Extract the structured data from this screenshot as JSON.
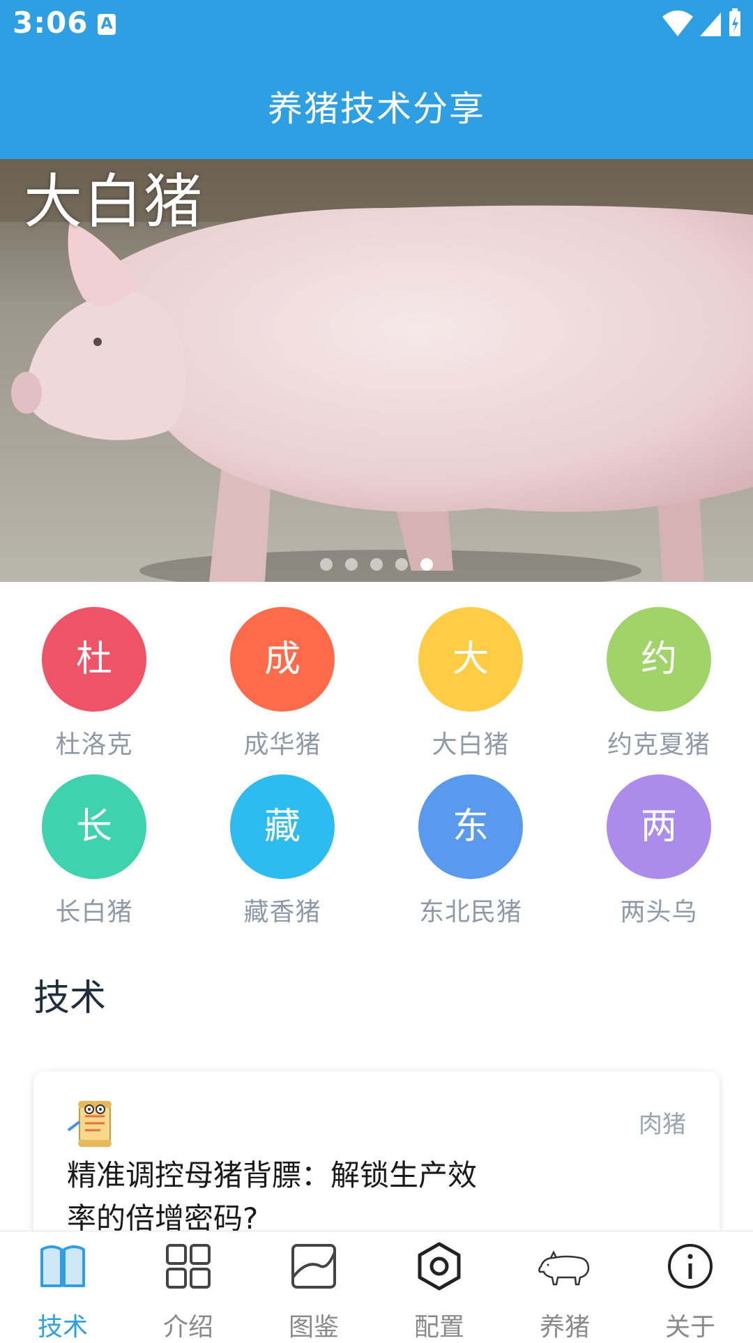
{
  "status_bar": {
    "time": "3:06",
    "notification_icon": "A"
  },
  "app_bar": {
    "title": "养猪技术分享"
  },
  "banner": {
    "caption": "大白猪",
    "page_count": 5,
    "active_index": 4
  },
  "categories": [
    {
      "initial": "杜",
      "label": "杜洛克",
      "color": "#ef5367"
    },
    {
      "initial": "成",
      "label": "成华猪",
      "color": "#fd6b4b"
    },
    {
      "initial": "大",
      "label": "大白猪",
      "color": "#fecd45"
    },
    {
      "initial": "约",
      "label": "约克夏猪",
      "color": "#a0d468"
    },
    {
      "initial": "长",
      "label": "长白猪",
      "color": "#3ed2ad"
    },
    {
      "initial": "藏",
      "label": "藏香猪",
      "color": "#2cbcf0"
    },
    {
      "initial": "东",
      "label": "东北民猪",
      "color": "#5a9aee"
    },
    {
      "initial": "两",
      "label": "两头乌",
      "color": "#ab8ceb"
    }
  ],
  "section": {
    "title": "技术"
  },
  "article": {
    "tag": "肉猪",
    "title": "精准调控母猪背膘：解锁生产效率的倍增密码?"
  },
  "bottom_nav": [
    {
      "label": "技术",
      "icon": "book-icon",
      "active": true
    },
    {
      "label": "介绍",
      "icon": "grid-icon",
      "active": false
    },
    {
      "label": "图鉴",
      "icon": "gallery-icon",
      "active": false
    },
    {
      "label": "配置",
      "icon": "hexagon-settings-icon",
      "active": false
    },
    {
      "label": "养猪",
      "icon": "pig-icon",
      "active": false
    },
    {
      "label": "关于",
      "icon": "info-icon",
      "active": false
    }
  ],
  "colors": {
    "primary": "#2f9fe3",
    "inactive_nav": "#8a8a8a"
  }
}
